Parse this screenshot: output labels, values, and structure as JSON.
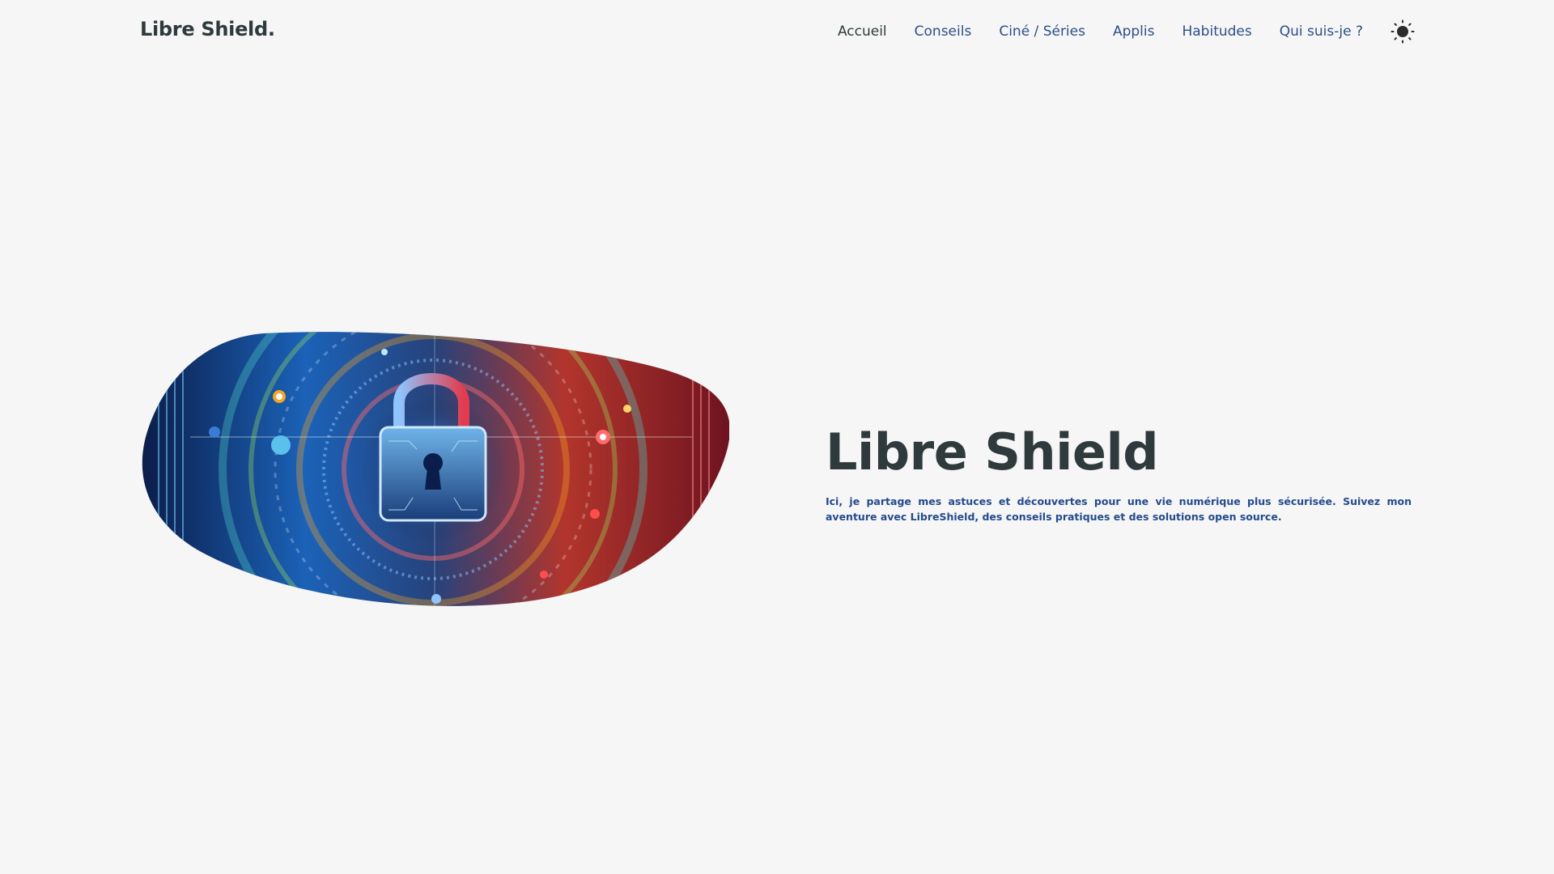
{
  "site": {
    "logo": "Libre Shield."
  },
  "nav": {
    "items": [
      {
        "label": "Accueil",
        "active": true
      },
      {
        "label": "Conseils",
        "active": false
      },
      {
        "label": "Ciné / Séries",
        "active": false
      },
      {
        "label": "Applis",
        "active": false
      },
      {
        "label": "Habitudes",
        "active": false
      },
      {
        "label": "Qui suis-je ?",
        "active": false
      }
    ],
    "theme_toggle_icon": "sun-icon"
  },
  "hero": {
    "image_icon": "padlock-cyber-illustration",
    "title": "Libre Shield",
    "description": "Ici, je partage mes astuces et découvertes pour une vie numérique plus sécurisée. Suivez mon aventure avec LibreShield, des conseils pratiques et des solutions open source."
  },
  "colors": {
    "background": "#f6f6f6",
    "text_dark": "#2f3a3c",
    "accent_blue": "#2a4f8a"
  }
}
